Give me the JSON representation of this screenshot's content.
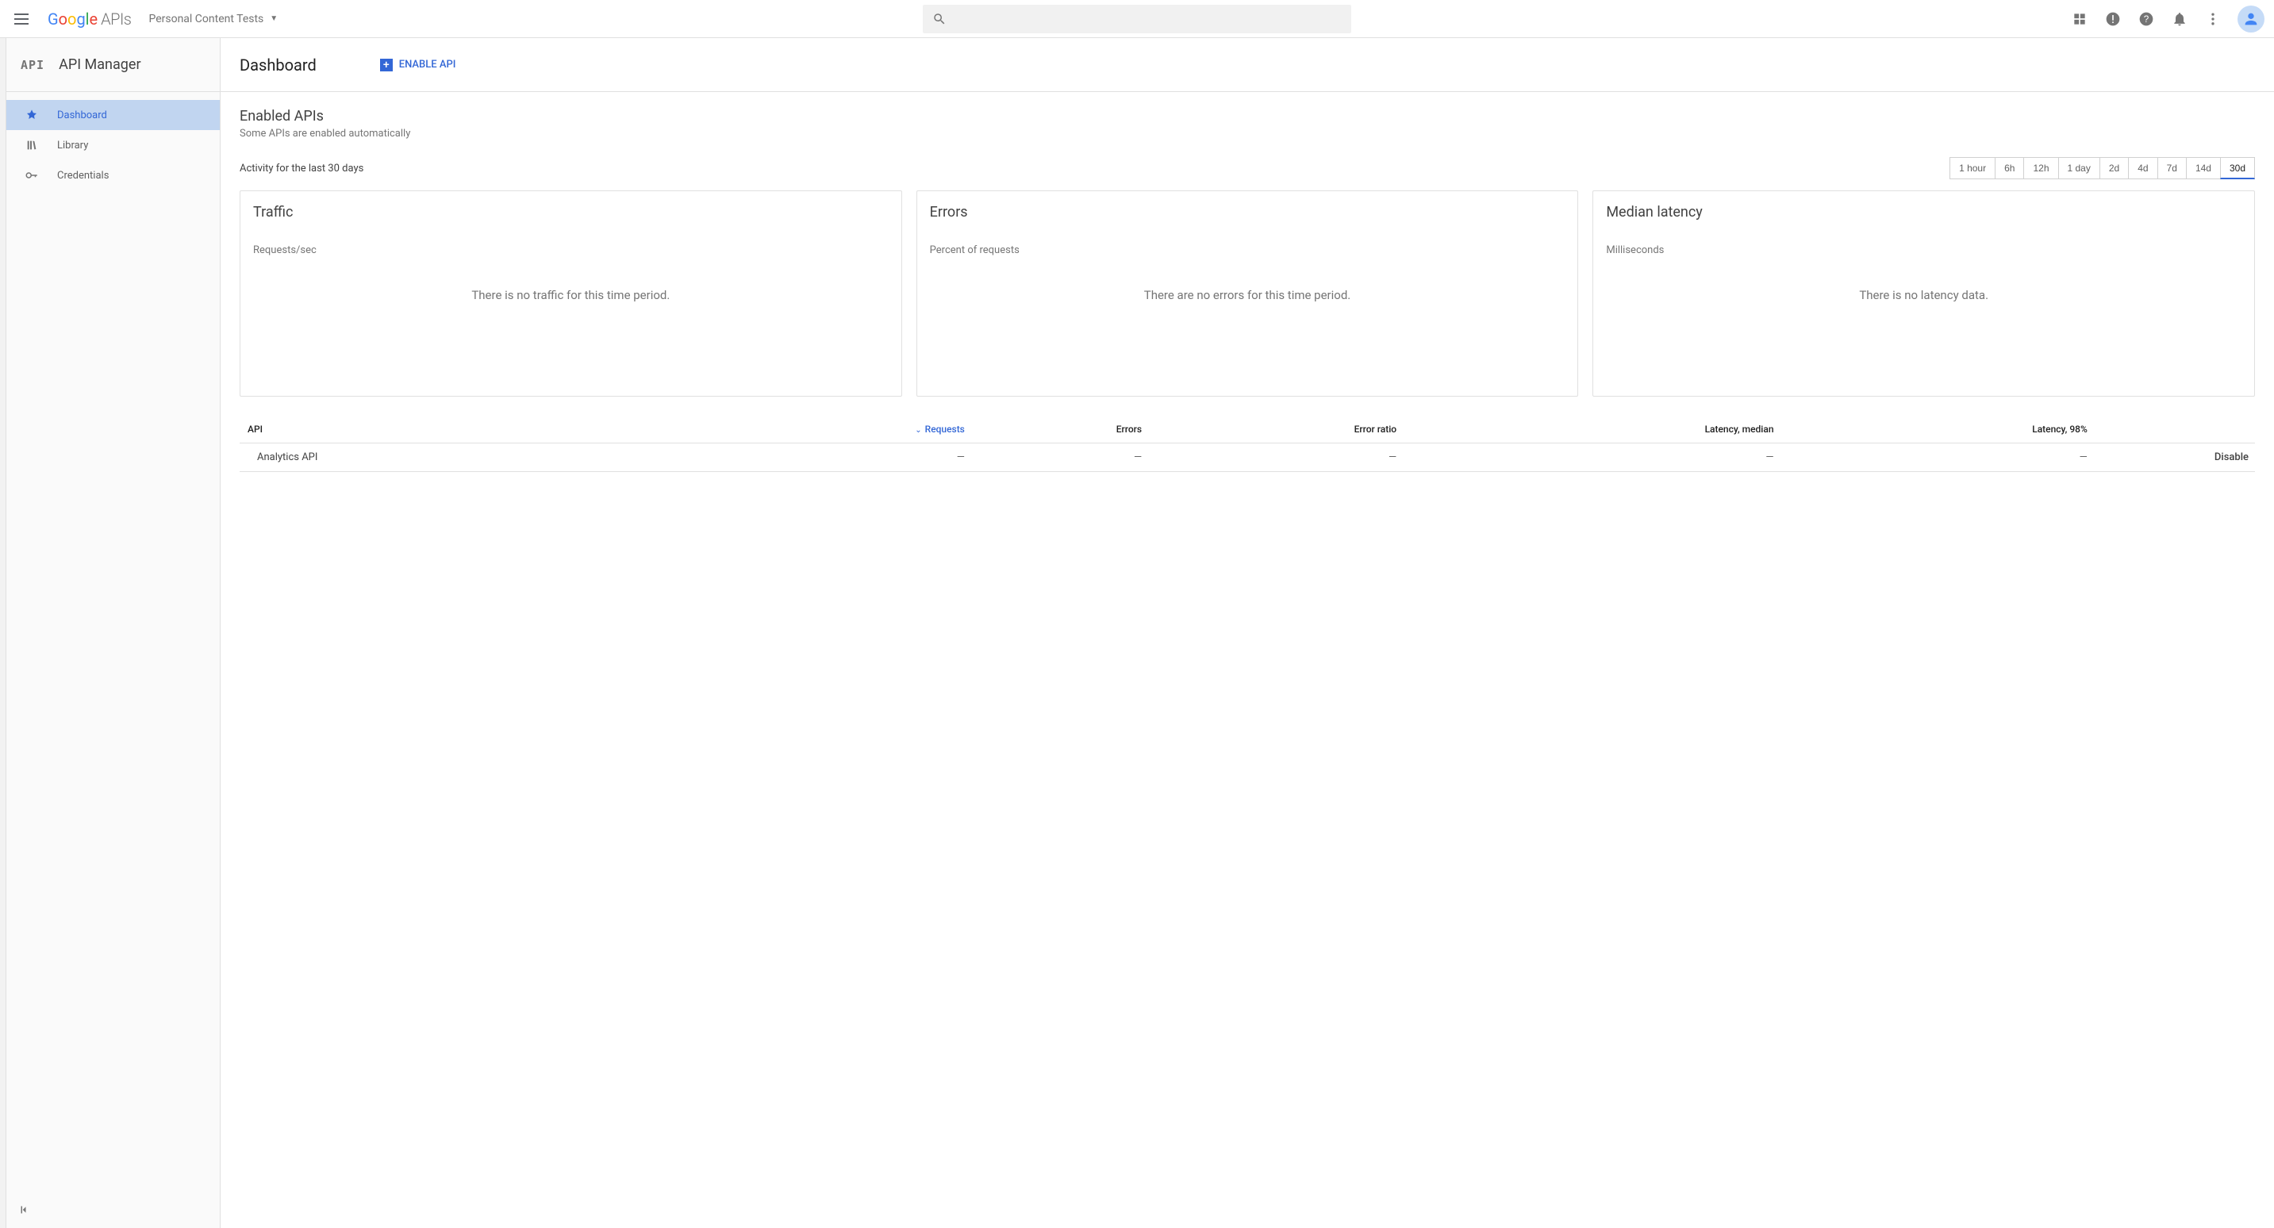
{
  "header": {
    "product": "APIs",
    "project_name": "Personal Content Tests"
  },
  "sidebar": {
    "title": "API Manager",
    "badge": "API",
    "items": [
      {
        "label": "Dashboard",
        "icon": "dashboard"
      },
      {
        "label": "Library",
        "icon": "library"
      },
      {
        "label": "Credentials",
        "icon": "key"
      }
    ]
  },
  "page": {
    "title": "Dashboard",
    "enable_label": "ENABLE API"
  },
  "enabled": {
    "title": "Enabled APIs",
    "subtitle": "Some APIs are enabled automatically",
    "activity_label": "Activity for the last 30 days"
  },
  "ranges": [
    "1 hour",
    "6h",
    "12h",
    "1 day",
    "2d",
    "4d",
    "7d",
    "14d",
    "30d"
  ],
  "active_range": "30d",
  "cards": {
    "traffic": {
      "title": "Traffic",
      "metric": "Requests/sec",
      "empty": "There is no traffic for this time period."
    },
    "errors": {
      "title": "Errors",
      "metric": "Percent of requests",
      "empty": "There are no errors for this time period."
    },
    "latency": {
      "title": "Median latency",
      "metric": "Milliseconds",
      "empty": "There is no latency data."
    }
  },
  "table": {
    "columns": [
      "API",
      "Requests",
      "Errors",
      "Error ratio",
      "Latency, median",
      "Latency, 98%",
      ""
    ],
    "sort_column": "Requests",
    "rows": [
      {
        "api": "Analytics API",
        "requests": "—",
        "errors": "—",
        "ratio": "—",
        "lat_med": "—",
        "lat_98": "—",
        "action": "Disable"
      }
    ]
  }
}
